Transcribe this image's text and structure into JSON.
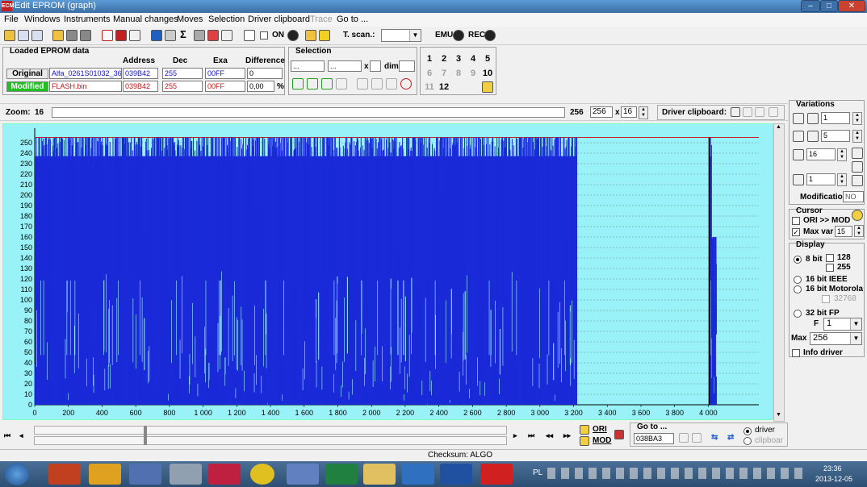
{
  "window": {
    "title": "Edit EPROM (graph)",
    "app_icon_text": "ECM",
    "min": "–",
    "max": "□",
    "close": "✕"
  },
  "menu": [
    "File",
    "Windows",
    "Instruments",
    "Manual changes",
    "Moves",
    "Selection",
    "Driver clipboard",
    "Trace",
    "Go to ..."
  ],
  "toolbar": {
    "on_label": "ON",
    "tscan_label": "T. scan.:",
    "tscan_value": "",
    "emu_label": "EMU",
    "rec_label": "REC"
  },
  "loaded": {
    "title": "Loaded EPROM data",
    "headers": [
      "Address",
      "Dec",
      "Exa",
      "Difference"
    ],
    "original": {
      "label": "Original",
      "file": "Alfa_0261S01032_369",
      "address": "039B42",
      "dec": "255",
      "exa": "00FF",
      "diff": "0"
    },
    "modified": {
      "label": "Modified",
      "file": "FLASH.bin",
      "address": "039B42",
      "dec": "255",
      "exa": "00FF",
      "diff": "0,00",
      "pct": "%"
    }
  },
  "selection": {
    "title": "Selection",
    "from": "...",
    "to": "...",
    "x_label": "x",
    "dim_label": "dim."
  },
  "numgrid": [
    "1",
    "2",
    "3",
    "4",
    "5",
    "6",
    "7",
    "8",
    "9",
    "10",
    "11",
    "12"
  ],
  "zoom": {
    "label": "Zoom:",
    "value": "16",
    "right_value": "256",
    "box_value": "256",
    "x": "x",
    "step": "16"
  },
  "driver_clipboard": {
    "label": "Driver clipboard:"
  },
  "variations": {
    "title": "Variations",
    "v1": "1",
    "v2": "5",
    "v3": "16",
    "v4": "1",
    "modification_label": "Modification",
    "modification_value": "NO"
  },
  "cursor": {
    "title": "Cursor",
    "ori_mod": "ORI >> MOD",
    "max_var_label": "Max var",
    "max_var_value": "15"
  },
  "display": {
    "title": "Display",
    "bit8": "8 bit",
    "o128": "128",
    "o255": "255",
    "ieee": "16 bit IEEE",
    "motorola": "16 bit Motorola",
    "o32768": "32768",
    "fp32": "32 bit FP",
    "f_label": "F",
    "f_value": "1",
    "max_label": "Max",
    "max_value": "256",
    "info_driver": "Info driver"
  },
  "bottom": {
    "ori": "ORI",
    "mod": "MOD",
    "goto_label": "Go to ...",
    "goto_value": "038BA3",
    "driver": "driver",
    "clipboard": "clipboar"
  },
  "status": {
    "checksum": "Checksum: ALGO"
  },
  "taskbar": {
    "lang": "PL",
    "time": "23:36",
    "date": "2013-12-05"
  },
  "chart_data": {
    "type": "bar",
    "title": "",
    "xlabel": "",
    "ylabel": "",
    "xlim": [
      0,
      4300
    ],
    "ylim": [
      0,
      260
    ],
    "x_ticks": [
      "0",
      "200",
      "400",
      "600",
      "800",
      "1 000",
      "1 200",
      "1 400",
      "1 600",
      "1 800",
      "2 000",
      "2 200",
      "2 400",
      "2 600",
      "2 800",
      "3 000",
      "3 200",
      "3 400",
      "3 600",
      "3 800",
      "4 000"
    ],
    "y_ticks": [
      "0",
      "10",
      "20",
      "30",
      "40",
      "50",
      "60",
      "70",
      "80",
      "90",
      "100",
      "110",
      "120",
      "130",
      "140",
      "150",
      "160",
      "170",
      "180",
      "190",
      "200",
      "210",
      "220",
      "230",
      "240",
      "250"
    ],
    "grid": true,
    "series": [
      {
        "values_range": [
          [
            0,
            3220
          ],
          [
            4005,
            4020
          ],
          [
            4020,
            4050
          ]
        ],
        "max_values": [
          255,
          255,
          160
        ]
      }
    ],
    "colors": {
      "background": "#99f2f7",
      "bars": "#1a2ad8",
      "top_line": "#cc2020",
      "grid": "#6a8a8a"
    }
  }
}
